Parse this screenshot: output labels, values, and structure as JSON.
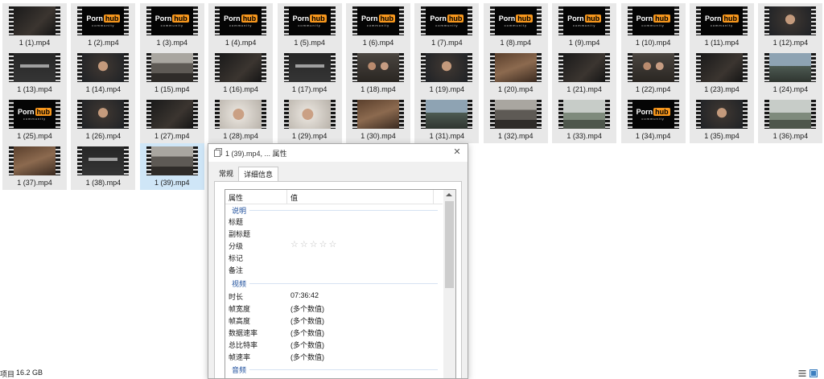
{
  "files": [
    {
      "name": "1 (1).mp4",
      "thumb": "dark-scene"
    },
    {
      "name": "1 (2).mp4",
      "thumb": "logo"
    },
    {
      "name": "1 (3).mp4",
      "thumb": "logo"
    },
    {
      "name": "1 (4).mp4",
      "thumb": "logo"
    },
    {
      "name": "1 (5).mp4",
      "thumb": "logo"
    },
    {
      "name": "1 (6).mp4",
      "thumb": "logo"
    },
    {
      "name": "1 (7).mp4",
      "thumb": "logo"
    },
    {
      "name": "1 (8).mp4",
      "thumb": "logo"
    },
    {
      "name": "1 (9).mp4",
      "thumb": "logo"
    },
    {
      "name": "1 (10).mp4",
      "thumb": "logo"
    },
    {
      "name": "1 (11).mp4",
      "thumb": "logo"
    },
    {
      "name": "1 (12).mp4",
      "thumb": "person"
    },
    {
      "name": "1 (13).mp4",
      "thumb": "title-card"
    },
    {
      "name": "1 (14).mp4",
      "thumb": "person"
    },
    {
      "name": "1 (15).mp4",
      "thumb": "street"
    },
    {
      "name": "1 (16).mp4",
      "thumb": "dark-scene"
    },
    {
      "name": "1 (17).mp4",
      "thumb": "title-card"
    },
    {
      "name": "1 (18).mp4",
      "thumb": "people"
    },
    {
      "name": "1 (19).mp4",
      "thumb": "person"
    },
    {
      "name": "1 (20).mp4",
      "thumb": "indoor"
    },
    {
      "name": "1 (21).mp4",
      "thumb": "dark-scene"
    },
    {
      "name": "1 (22).mp4",
      "thumb": "people"
    },
    {
      "name": "1 (23).mp4",
      "thumb": "dark-scene"
    },
    {
      "name": "1 (24).mp4",
      "thumb": "outdoor"
    },
    {
      "name": "1 (25).mp4",
      "thumb": "logo"
    },
    {
      "name": "1 (26).mp4",
      "thumb": "person"
    },
    {
      "name": "1 (27).mp4",
      "thumb": "dark-scene"
    },
    {
      "name": "1 (28).mp4",
      "thumb": "bright-person"
    },
    {
      "name": "1 (29).mp4",
      "thumb": "bright-person"
    },
    {
      "name": "1 (30).mp4",
      "thumb": "indoor"
    },
    {
      "name": "1 (31).mp4",
      "thumb": "outdoor"
    },
    {
      "name": "1 (32).mp4",
      "thumb": "street"
    },
    {
      "name": "1 (33).mp4",
      "thumb": "landscape"
    },
    {
      "name": "1 (34).mp4",
      "thumb": "logo"
    },
    {
      "name": "1 (35).mp4",
      "thumb": "person"
    },
    {
      "name": "1 (36).mp4",
      "thumb": "landscape"
    },
    {
      "name": "1 (37).mp4",
      "thumb": "indoor"
    },
    {
      "name": "1 (38).mp4",
      "thumb": "title-card"
    },
    {
      "name": "1 (39).mp4",
      "thumb": "street"
    }
  ],
  "logo": {
    "part1": "Porn",
    "part2": "hub",
    "sub": "community"
  },
  "dialog": {
    "title": "1 (39).mp4, ... 属性",
    "close": "✕",
    "tabs": {
      "general": "常规",
      "details": "详细信息"
    },
    "columns": {
      "property": "属性",
      "value": "值"
    },
    "groups": {
      "description": "说明",
      "video": "视频",
      "audio": "音频"
    },
    "rows": {
      "title": {
        "k": "标题",
        "v": ""
      },
      "subtitle": {
        "k": "副标题",
        "v": ""
      },
      "rating": {
        "k": "分级",
        "v": "☆☆☆☆☆"
      },
      "tags": {
        "k": "标记",
        "v": ""
      },
      "comments": {
        "k": "备注",
        "v": ""
      },
      "length": {
        "k": "时长",
        "v": "07:36:42"
      },
      "frame_width": {
        "k": "帧宽度",
        "v": "(多个数值)"
      },
      "frame_height": {
        "k": "帧高度",
        "v": "(多个数值)"
      },
      "data_rate": {
        "k": "数据速率",
        "v": "(多个数值)"
      },
      "total_bitrate": {
        "k": "总比特率",
        "v": "(多个数值)"
      },
      "frame_rate": {
        "k": "帧速率",
        "v": "(多个数值)"
      }
    }
  },
  "status": {
    "items": "项目",
    "size": "16.2 GB"
  },
  "colors": {
    "selection": "#cfe6f7",
    "accent": "#f7971d",
    "group_text": "#1e4f9c"
  }
}
